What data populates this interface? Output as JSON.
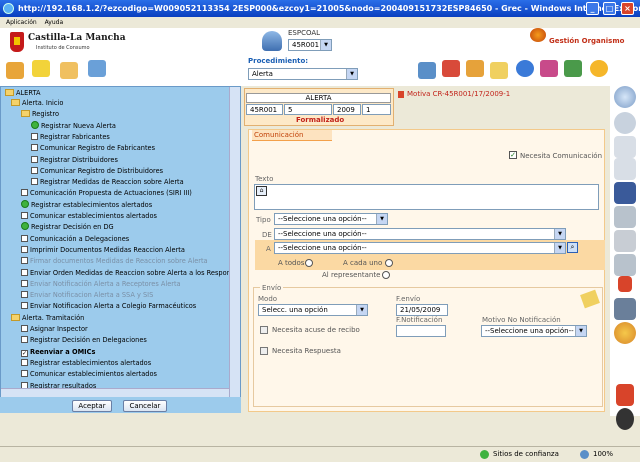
{
  "window": {
    "title": "http://192.168.1.2/?ezcodigo=W009052113354 2ESP000&ezcoy1=21005&nodo=200409151732ESP84650 - Grec - Windows Internet Explorer"
  },
  "menu": {
    "items": [
      "Aplicación",
      "Ayuda"
    ]
  },
  "header": {
    "logo_title": "Castilla-La Mancha",
    "logo_subtitle": "Instituto de Consumo",
    "user_label": "ESPCOAL",
    "user_select": "45R001",
    "gestion_label": "Gestión Organismo"
  },
  "procedure": {
    "label": "Procedimiento:",
    "value": "Alerta"
  },
  "record": {
    "title": "ALERTA",
    "code": "45R001",
    "num": "5",
    "year": "2009",
    "seq": "1",
    "state": "Formalizado",
    "motive_label": "Motiva CR-45R001/17/2009-1"
  },
  "tree": {
    "root": "ALERTA",
    "items": [
      {
        "label": "Alerta. Inicio",
        "type": "folder",
        "level": 1
      },
      {
        "label": "Registro",
        "type": "folder",
        "level": 2
      },
      {
        "label": "Registrar Nueva Alerta",
        "type": "green",
        "level": 3
      },
      {
        "label": "Registrar Fabricantes",
        "type": "box",
        "level": 3
      },
      {
        "label": "Comunicar Registro de Fabricantes",
        "type": "box",
        "level": 3
      },
      {
        "label": "Registrar Distribuidores",
        "type": "box",
        "level": 3
      },
      {
        "label": "Comunicar Registro de Distribuidores",
        "type": "box",
        "level": 3
      },
      {
        "label": "Registrar Medidas de Reaccion sobre Alerta",
        "type": "box",
        "level": 3
      },
      {
        "label": "Comunicación Propuesta de Actuaciones (SIRI III)",
        "type": "box",
        "level": 2
      },
      {
        "label": "Registrar establecimientos alertados",
        "type": "green",
        "level": 2
      },
      {
        "label": "Comunicar establecimientos alertados",
        "type": "box",
        "level": 2
      },
      {
        "label": "Registrar Decisión en DG",
        "type": "green",
        "level": 2
      },
      {
        "label": "Comunicación a Delegaciones",
        "type": "box",
        "level": 2
      },
      {
        "label": "Imprimir Documentos Medidas Reaccion Alerta",
        "type": "box",
        "level": 2
      },
      {
        "label": "Firmar documentos Medidas de Reaccion sobre Alerta",
        "type": "box",
        "level": 2,
        "dim": true
      },
      {
        "label": "Enviar Orden Medidas de Reaccion sobre Alerta a los Responsables",
        "type": "box",
        "level": 2
      },
      {
        "label": "Enviar Notificación Alerta a Receptores Alerta",
        "type": "box",
        "level": 2,
        "dim": true
      },
      {
        "label": "Enviar Notificacion Alerta a SSA y SIS",
        "type": "box",
        "level": 2,
        "dim": true
      },
      {
        "label": "Enviar Notificacion Alerta a Colegio Farmacéuticos",
        "type": "box",
        "level": 2
      },
      {
        "label": "Alerta. Tramitación",
        "type": "folder",
        "level": 1
      },
      {
        "label": "Asignar Inspector",
        "type": "box",
        "level": 2
      },
      {
        "label": "Registrar Decisión en Delegaciones",
        "type": "box",
        "level": 2
      },
      {
        "label": "Reenviar a OMICs",
        "type": "check",
        "level": 2,
        "bold": true
      },
      {
        "label": "Registrar establecimientos alertados",
        "type": "box",
        "level": 2
      },
      {
        "label": "Comunicar establecimientos alertados",
        "type": "box",
        "level": 2
      },
      {
        "label": "Registrar resultados",
        "type": "box",
        "level": 2
      }
    ],
    "accept_label": "Aceptar",
    "cancel_label": "Cancelar"
  },
  "form": {
    "tab_label": "Comunicación",
    "needs_comm_label": "Necesita Comunicación",
    "texto_label": "Texto",
    "tipo_label": "Tipo",
    "tipo_value": "--Seleccione una opción--",
    "de_label": "DE",
    "de_value": "--Seleccione una opción--",
    "a_label": "A",
    "a_value": "--Seleccione una opción--",
    "a_todos": "A todos",
    "a_cada_uno": "A cada uno",
    "al_representante": "Al representante",
    "envio_label": "Envío",
    "modo_label": "Modo",
    "modo_value": "Selecc. una opción",
    "fenvio_label": "F.envío",
    "fenvio_value": "21/05/2009",
    "acuse_label": "Necesita acuse de recibo",
    "fnotif_label": "F.Notificación",
    "motivo_label": "Motivo No Notificación",
    "motivo_value": "--Seleccione una opción--",
    "respuesta_label": "Necesita Respuesta"
  },
  "status": {
    "trust": "Sitios de confianza",
    "zoom": "100%"
  }
}
